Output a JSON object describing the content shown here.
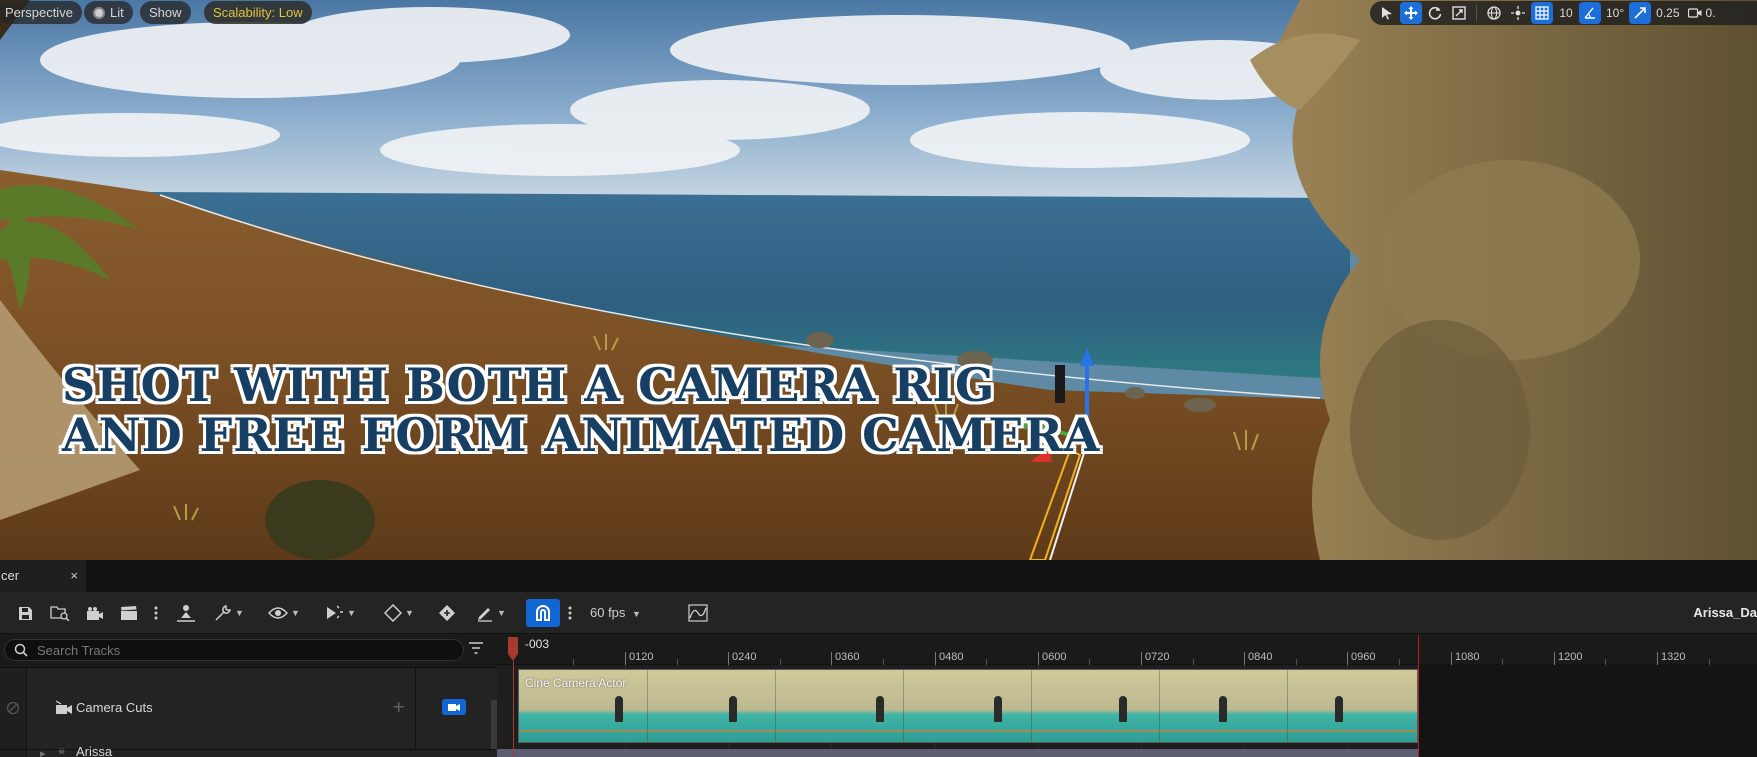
{
  "viewport": {
    "toolbar": {
      "perspective_label": "Perspective",
      "lit_label": "Lit",
      "show_label": "Show",
      "scalability_label": "Scalability: Low",
      "grid_snap_value": "10",
      "rotation_snap_value": "10°",
      "scale_snap_value": "0.25",
      "camera_speed_value": "0."
    },
    "overlay_text": {
      "line1": "SHOT WITH BOTH A CAMERA RIG",
      "line2": "AND FREE FORM ANIMATED CAMERA"
    }
  },
  "sequencer": {
    "tab_label": "cer",
    "tab_close": "×",
    "fps_label": "60 fps",
    "sequence_name": "Arissa_Da",
    "search": {
      "placeholder": "Search Tracks"
    },
    "tracks": [
      {
        "label": "Camera Cuts"
      },
      {
        "label": "Arissa"
      }
    ],
    "timeline": {
      "current_time": "-003",
      "ruler_labels": [
        "0120",
        "0240",
        "0360",
        "0480",
        "0600",
        "0720",
        "0840",
        "0960",
        "1080",
        "1200",
        "1320"
      ],
      "clip_label": "Cine Camera Actor"
    }
  },
  "colors": {
    "accent_blue": "#1266d4",
    "scalability_text": "#e6c33a",
    "playhead": "#a53a2e",
    "overlay_text": "#173e63"
  }
}
